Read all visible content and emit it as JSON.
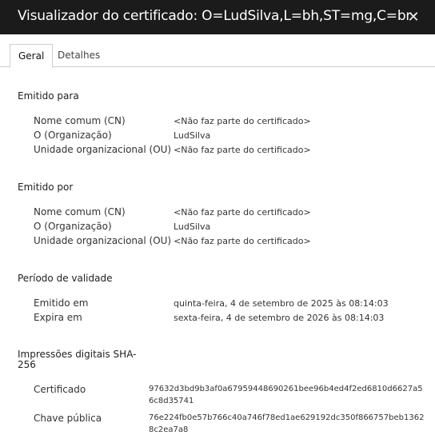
{
  "window": {
    "title": "Visualizador do certificado: O=LudSilva,L=bh,ST=mg,C=br",
    "close_glyph": "✕"
  },
  "tabs": [
    {
      "label": "Geral",
      "active": true
    },
    {
      "label": "Detalhes",
      "active": false
    }
  ],
  "issued_to": {
    "heading": "Emitido para",
    "rows": [
      {
        "label": "Nome comum (CN)",
        "value": "<Não faz parte do certificado>"
      },
      {
        "label": "O (Organização)",
        "value": "LudSilva"
      },
      {
        "label": "Unidade organizacional (OU)",
        "value": "<Não faz parte do certificado>"
      }
    ]
  },
  "issued_by": {
    "heading": "Emitido por",
    "rows": [
      {
        "label": "Nome comum (CN)",
        "value": "<Não faz parte do certificado>"
      },
      {
        "label": "O (Organização)",
        "value": "LudSilva"
      },
      {
        "label": "Unidade organizacional (OU)",
        "value": "<Não faz parte do certificado>"
      }
    ]
  },
  "validity": {
    "heading": "Período de validade",
    "rows": [
      {
        "label": "Emitido em",
        "value": "quinta-feira, 4 de setembro de 2025 às 08:14:03"
      },
      {
        "label": "Expira em",
        "value": "sexta-feira, 4 de setembro de 2026 às 08:14:03"
      }
    ]
  },
  "fingerprints": {
    "heading": "Impressões digitais SHA-256",
    "rows": [
      {
        "label": "Certificado",
        "value": "97632d3bd9b3af0a6795944869026​1bee96b4ed4f2ed6810d6627a56c8d35741"
      },
      {
        "label": "Chave pública",
        "value": "76e224fb0e57b766c40a746f78ed1ae629192dc350f866757beb13628c2ea7a8"
      }
    ]
  }
}
